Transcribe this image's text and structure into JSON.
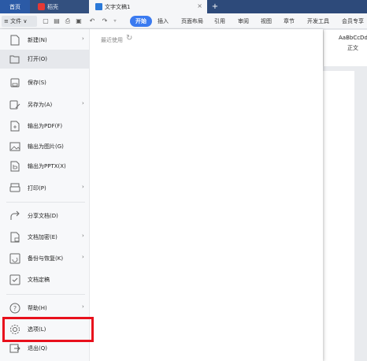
{
  "tabs": {
    "home": "首页",
    "daoke": "稻壳",
    "doc": "文字文稿1",
    "close": "×",
    "add": "+"
  },
  "ribbon": {
    "file_label": "≡ 文件 ∨",
    "tabs": [
      "开始",
      "插入",
      "页面布局",
      "引用",
      "审阅",
      "视图",
      "章节",
      "开发工具",
      "会员专享"
    ],
    "active_tab": "开始"
  },
  "styles": {
    "sample": "AaBbCcDd",
    "name": "正文"
  },
  "file_menu": {
    "recent_label": "最近使用",
    "items": [
      {
        "label": "新建(N)",
        "has_submenu": true,
        "icon": "new-doc-icon"
      },
      {
        "label": "打开(O)",
        "has_submenu": false,
        "icon": "folder-open-icon"
      },
      {
        "label": "保存(S)",
        "has_submenu": false,
        "icon": "save-icon"
      },
      {
        "label": "另存为(A)",
        "has_submenu": true,
        "icon": "save-as-icon"
      },
      {
        "label": "输出为PDF(F)",
        "has_submenu": false,
        "icon": "export-pdf-icon"
      },
      {
        "label": "输出为图片(G)",
        "has_submenu": false,
        "icon": "export-image-icon"
      },
      {
        "label": "输出为PPTX(X)",
        "has_submenu": false,
        "icon": "export-pptx-icon"
      },
      {
        "label": "打印(P)",
        "has_submenu": true,
        "icon": "printer-icon"
      },
      {
        "label": "分享文档(D)",
        "has_submenu": false,
        "icon": "share-icon"
      },
      {
        "label": "文档加密(E)",
        "has_submenu": true,
        "icon": "encrypt-icon"
      },
      {
        "label": "备份与恢复(K)",
        "has_submenu": true,
        "icon": "backup-icon"
      },
      {
        "label": "文档定稿",
        "has_submenu": false,
        "icon": "finalize-icon"
      },
      {
        "label": "帮助(H)",
        "has_submenu": true,
        "icon": "help-icon"
      },
      {
        "label": "选项(L)",
        "has_submenu": false,
        "icon": "options-gear-icon"
      },
      {
        "label": "退出(Q)",
        "has_submenu": false,
        "icon": "exit-icon"
      }
    ],
    "highlighted_item": "选项(L)"
  },
  "colors": {
    "highlight": "#e8101c",
    "accent": "#3a7af0"
  }
}
